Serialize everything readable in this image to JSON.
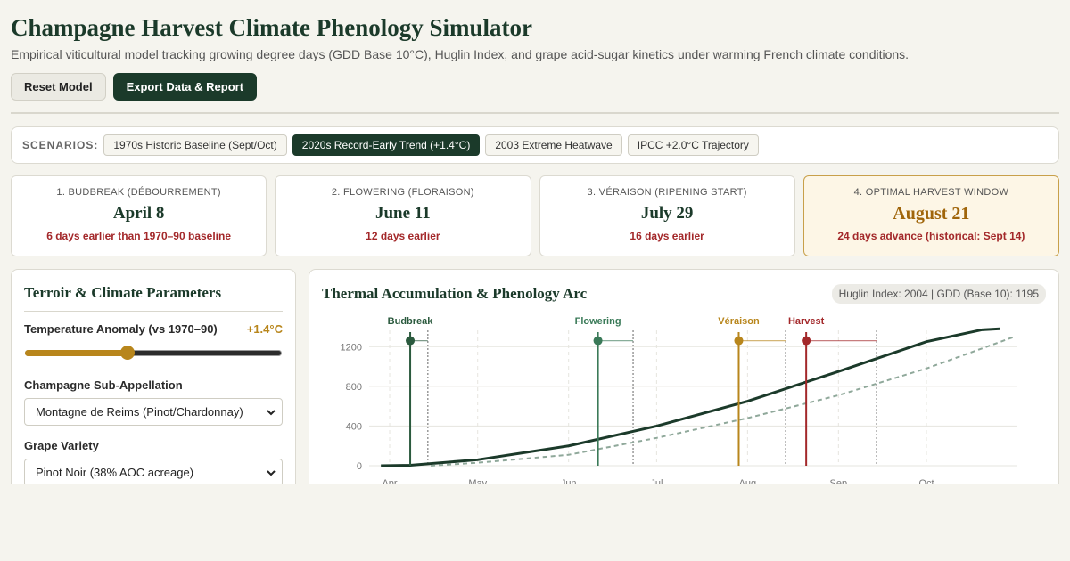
{
  "header": {
    "title": "Champagne Harvest Climate Phenology Simulator",
    "subtitle": "Empirical viticultural model tracking growing degree days (GDD Base 10°C), Huglin Index, and grape acid-sugar kinetics under warming French climate conditions."
  },
  "actions": {
    "reset": "Reset Model",
    "export": "Export Data & Report"
  },
  "scenarios": {
    "label": "SCENARIOS:",
    "items": [
      {
        "label": "1970s Historic Baseline (Sept/Oct)",
        "active": false
      },
      {
        "label": "2020s Record-Early Trend (+1.4°C)",
        "active": true
      },
      {
        "label": "2003 Extreme Heatwave",
        "active": false
      },
      {
        "label": "IPCC +2.0°C Trajectory",
        "active": false
      }
    ]
  },
  "stages": [
    {
      "title": "1. BUDBREAK (DÉBOURREMENT)",
      "date": "April 8",
      "delta": "6 days earlier than 1970–90 baseline"
    },
    {
      "title": "2. FLOWERING (FLORAISON)",
      "date": "June 11",
      "delta": "12 days earlier"
    },
    {
      "title": "3. VÉRAISON (RIPENING START)",
      "date": "July 29",
      "delta": "16 days earlier"
    },
    {
      "title": "4. OPTIMAL HARVEST WINDOW",
      "date": "August 21",
      "delta": "24 days advance (historical: Sept 14)"
    }
  ],
  "params": {
    "title": "Terroir & Climate Parameters",
    "anomaly_label": "Temperature Anomaly (vs 1970–90)",
    "anomaly_value": "+1.4°C",
    "anomaly_fraction": 0.4,
    "subappellation_label": "Champagne Sub-Appellation",
    "subappellation_value": "Montagne de Reims (Pinot/Chardonnay)",
    "variety_label": "Grape Variety",
    "variety_value": "Pinot Noir (38% AOC acreage)"
  },
  "chart": {
    "title": "Thermal Accumulation & Phenology Arc",
    "badge": "Huglin Index: 2004 | GDD (Base 10): 1195"
  },
  "colors": {
    "primary": "#1b3a2a",
    "budbreak": "#2b5a3e",
    "flowering": "#3a7a58",
    "veraison": "#b8861c",
    "harvest": "#a3282a"
  },
  "chart_data": {
    "type": "line",
    "title": "Thermal Accumulation & Phenology Arc",
    "x_ticks": [
      "Apr",
      "May",
      "Jun",
      "Jul",
      "Aug",
      "Sep",
      "Oct"
    ],
    "y_ticks": [
      0,
      400,
      800,
      1200
    ],
    "ylim": [
      0,
      1400
    ],
    "grid": true,
    "series": [
      {
        "style": "solid",
        "x": [
          "Mar 29",
          "Apr 8",
          "May 1",
          "Jun 1",
          "Jul 1",
          "Aug 1",
          "Sep 1",
          "Oct 1",
          "Oct 20",
          "Oct 26"
        ],
        "values": [
          0,
          5,
          60,
          200,
          400,
          650,
          950,
          1250,
          1370,
          1380
        ]
      },
      {
        "style": "dashed",
        "x": [
          "Apr 15",
          "May 1",
          "Jun 1",
          "Jul 1",
          "Aug 1",
          "Sep 1",
          "Oct 1",
          "Oct 31"
        ],
        "values": [
          0,
          30,
          110,
          280,
          480,
          710,
          980,
          1300
        ]
      }
    ],
    "events": [
      {
        "label": "Budbreak",
        "date": "Apr 8",
        "historical": "Apr 14"
      },
      {
        "label": "Flowering",
        "date": "Jun 11",
        "historical": "Jun 23"
      },
      {
        "label": "Véraison",
        "date": "Jul 29",
        "historical": "Aug 14"
      },
      {
        "label": "Harvest",
        "date": "Aug 21",
        "historical": "Sep 14"
      }
    ]
  }
}
